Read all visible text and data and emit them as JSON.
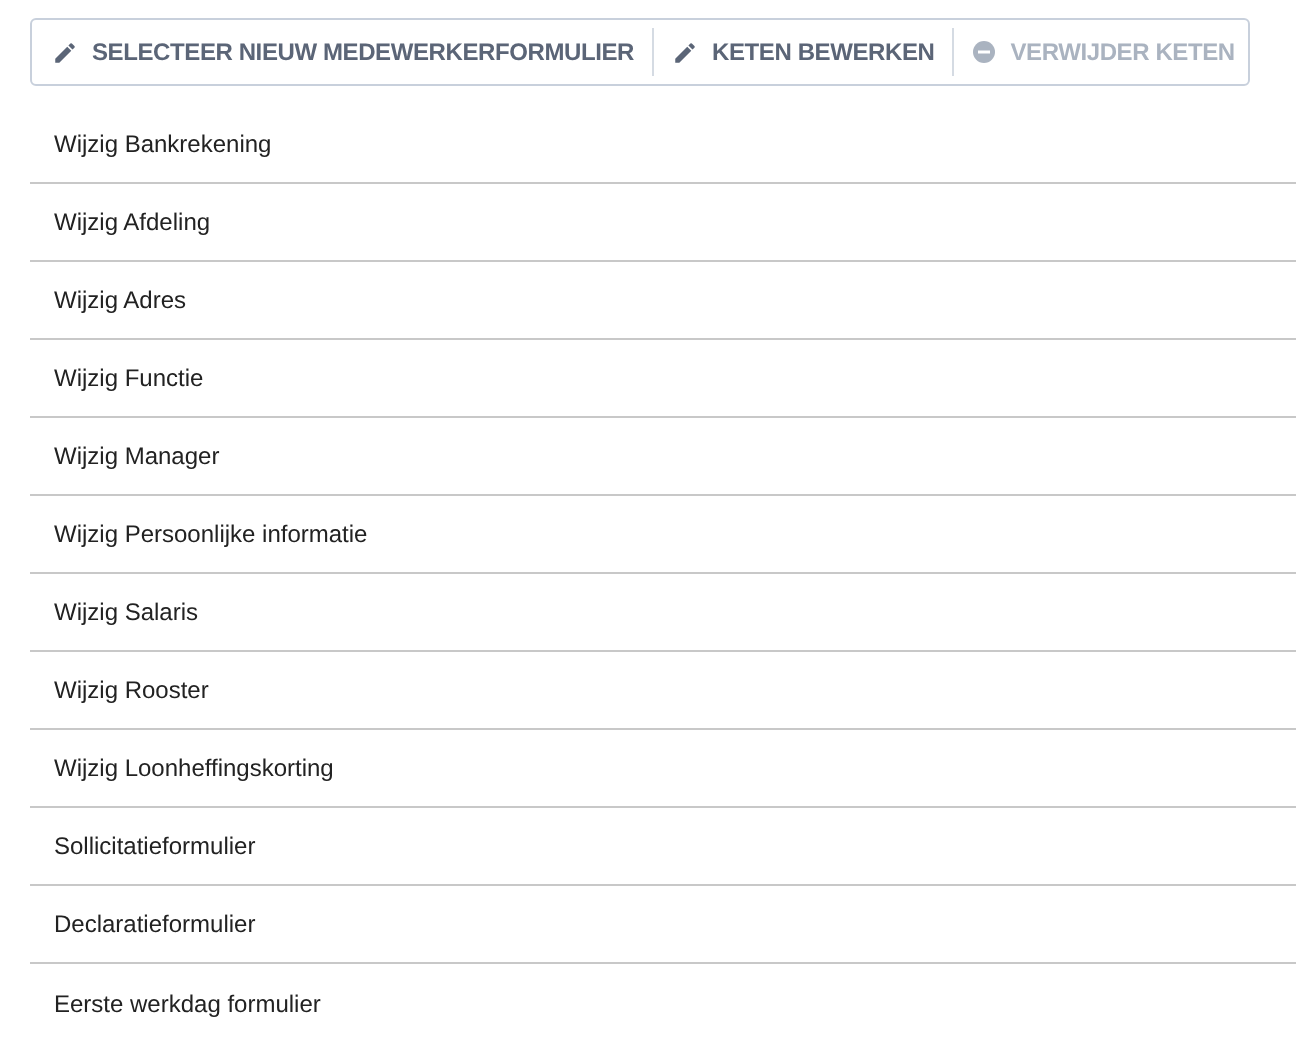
{
  "toolbar": [
    {
      "label": "SELECTEER NIEUW MEDEWERKERFORMULIER",
      "kind": "edit",
      "disabled": false
    },
    {
      "label": "KETEN BEWERKEN",
      "kind": "edit",
      "disabled": false
    },
    {
      "label": "VERWIJDER KETEN",
      "kind": "remove",
      "disabled": true
    }
  ],
  "forms": [
    "Wijzig Bankrekening",
    "Wijzig Afdeling",
    "Wijzig Adres",
    "Wijzig Functie",
    "Wijzig Manager",
    "Wijzig Persoonlijke informatie",
    "Wijzig Salaris",
    "Wijzig Rooster",
    "Wijzig Loonheffingskorting",
    "Sollicitatieformulier",
    "Declaratieformulier",
    "Eerste werkdag formulier"
  ]
}
